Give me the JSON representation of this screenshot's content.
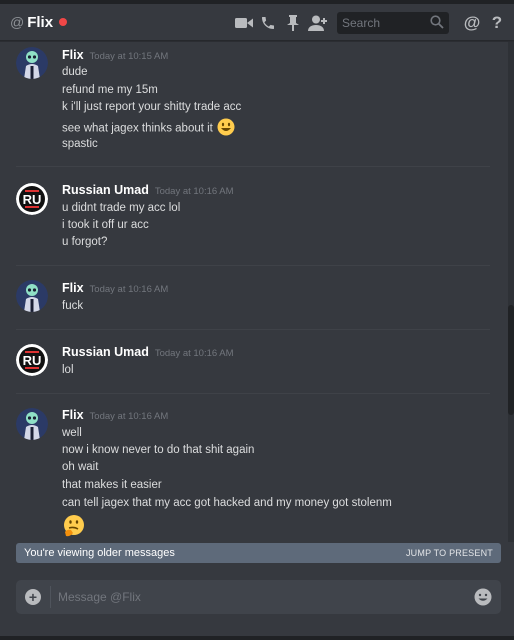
{
  "header": {
    "at_symbol": "@",
    "channel_name": "Flix",
    "status_color": "#f04747",
    "search_placeholder": "Search",
    "icons": [
      "video-call-icon",
      "phone-call-icon",
      "pin-icon",
      "add-friend-icon",
      "search-icon",
      "mention-icon",
      "help-icon"
    ],
    "mention_label": "@",
    "help_label": "?"
  },
  "messages": [
    {
      "author": "Flix",
      "avatar": "flix-avatar",
      "timestamp": "Today at 10:15 AM",
      "lines": [
        "dude",
        "refund me my 15m",
        "k i'll just report your shitty trade acc",
        "see what jagex thinks about it",
        "spastic"
      ],
      "emoji": "smiley"
    },
    {
      "author": "Russian Umad",
      "avatar": "ru-avatar",
      "timestamp": "Today at 10:16 AM",
      "lines": [
        "u didnt trade my acc lol",
        "i took it off ur acc",
        "u forgot?"
      ]
    },
    {
      "author": "Flix",
      "avatar": "flix-avatar",
      "timestamp": "Today at 10:16 AM",
      "lines": [
        "fuck"
      ]
    },
    {
      "author": "Russian Umad",
      "avatar": "ru-avatar",
      "timestamp": "Today at 10:16 AM",
      "lines": [
        "lol"
      ]
    },
    {
      "author": "Flix",
      "avatar": "flix-avatar",
      "timestamp": "Today at 10:16 AM",
      "lines": [
        "well",
        "now i know never to do that shit again",
        "oh wait",
        "that makes it easier",
        "can tell jagex that my acc got hacked and my money got stolenm"
      ],
      "emoji": "thinking"
    }
  ],
  "banner": {
    "text": "You're viewing older messages",
    "jump_label": "JUMP TO PRESENT"
  },
  "composer": {
    "placeholder": "Message @Flix",
    "plus_label": "+"
  },
  "colors": {
    "background": "#36393f",
    "banner": "#5e6a7a",
    "input": "#40444b",
    "timestamp": "#72767d",
    "status_dnd": "#f04747"
  }
}
